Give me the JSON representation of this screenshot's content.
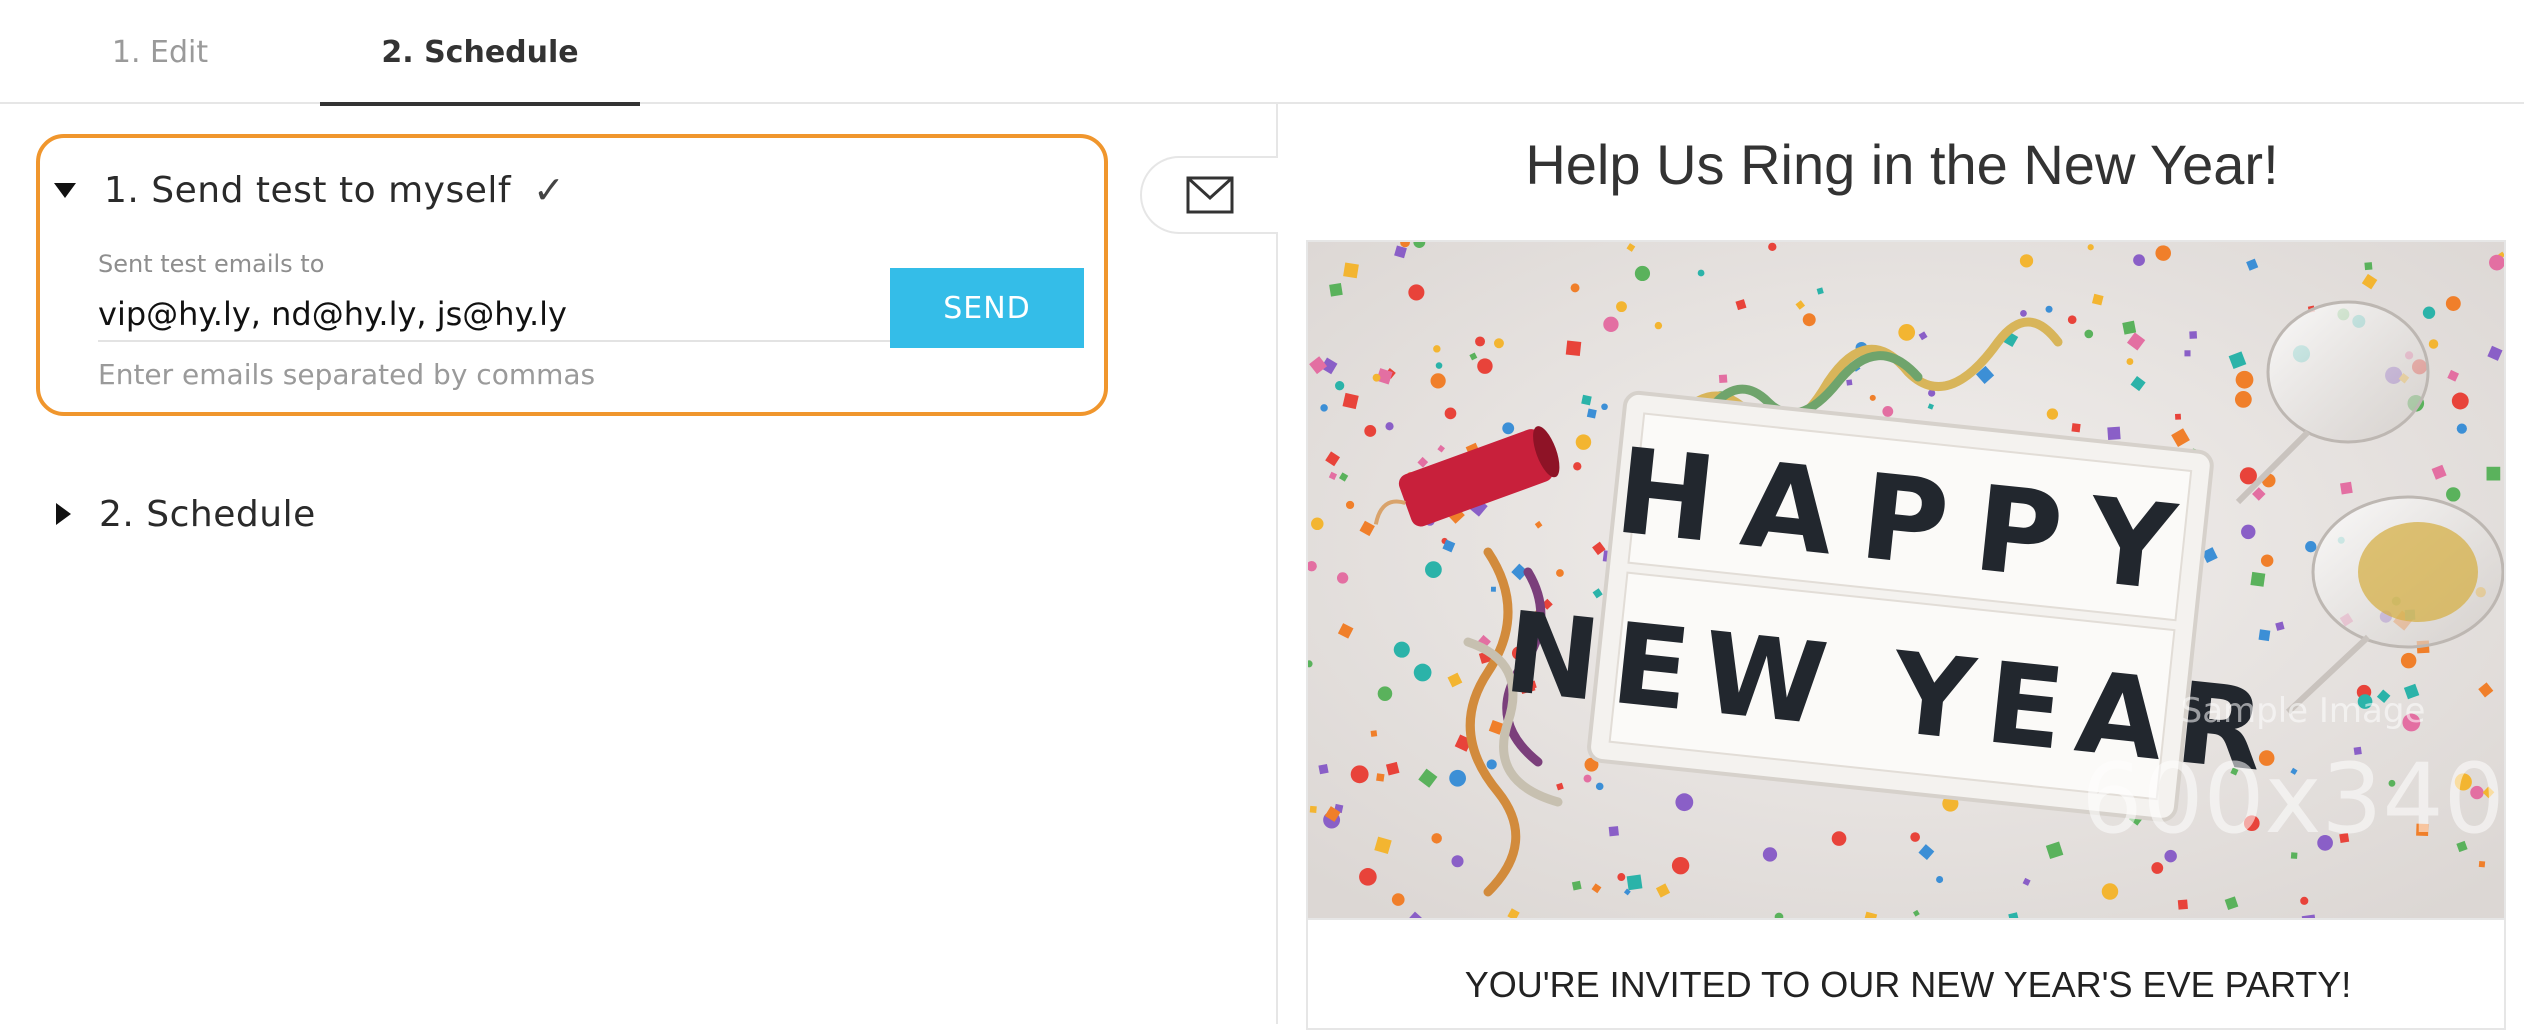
{
  "tabs": [
    {
      "label": "1. Edit",
      "active": false
    },
    {
      "label": "2. Schedule",
      "active": true
    }
  ],
  "steps": {
    "test": {
      "title": "1. Send test to myself",
      "check": "✓",
      "field_label": "Sent test emails to",
      "emails_value": "vip@hy.ly, nd@hy.ly, js@hy.ly",
      "hint": "Enter emails separated by commas",
      "send_label": "SEND",
      "expanded": true
    },
    "schedule": {
      "title": "2. Schedule",
      "expanded": false
    }
  },
  "preview": {
    "title": "Help Us Ring in the New Year!",
    "image": {
      "sign_line1": "HAPPY",
      "sign_line2": "NEW YEAR",
      "watermark_label": "Sample Image",
      "watermark_size": "600x340"
    },
    "invite_text": "YOU'RE INVITED TO OUR NEW YEAR'S EVE PARTY!"
  },
  "icons": {
    "mail_toggle": "envelope-icon"
  },
  "colors": {
    "accent_border": "#f0962d",
    "send_button": "#34bde8"
  }
}
